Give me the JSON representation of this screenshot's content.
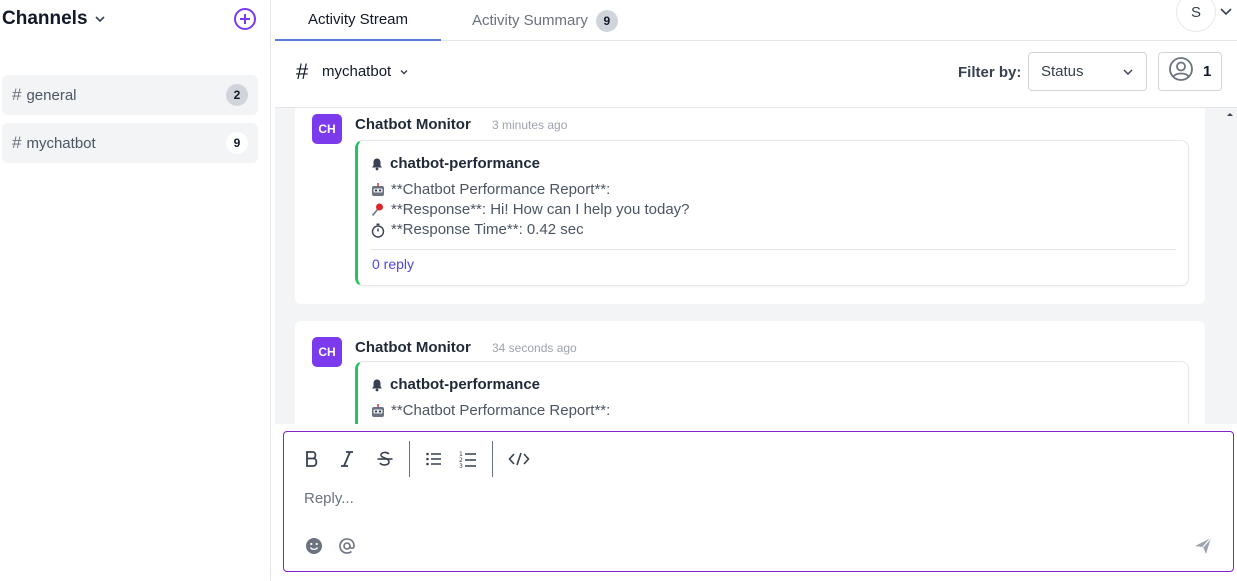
{
  "sidebar": {
    "title": "Channels",
    "channels": [
      {
        "name": "general",
        "count": "2"
      },
      {
        "name": "mychatbot",
        "count": "9"
      }
    ]
  },
  "tabs": {
    "activity_stream": "Activity Stream",
    "activity_summary": "Activity Summary",
    "summary_count": "9"
  },
  "user": {
    "initial": "S"
  },
  "channel_bar": {
    "hash": "#",
    "name": "mychatbot",
    "filter_label": "Filter by:",
    "filter_value": "Status",
    "members_count": "1"
  },
  "messages": [
    {
      "avatar": "CH",
      "author": "Chatbot Monitor",
      "time": "3 minutes ago",
      "attachment_title": "chatbot-performance",
      "lines": [
        {
          "icon": "robot-icon",
          "text": "**Chatbot Performance Report**:"
        },
        {
          "icon": "pushpin-icon",
          "text": "**Response**: Hi! How can I help you today?"
        },
        {
          "icon": "stopwatch-icon",
          "text": "**Response Time**: 0.42 sec"
        }
      ],
      "reply_label": "0 reply"
    },
    {
      "avatar": "CH",
      "author": "Chatbot Monitor",
      "time": "34 seconds ago",
      "attachment_title": "chatbot-performance",
      "lines": [
        {
          "icon": "robot-icon",
          "text": "**Chatbot Performance Report**:"
        }
      ]
    }
  ],
  "composer": {
    "placeholder": "Reply..."
  },
  "colors": {
    "accent": "#7c3aed",
    "attachment_border": "#22c55e",
    "link": "#4f46e5",
    "composer_border": "#7e22ce"
  }
}
